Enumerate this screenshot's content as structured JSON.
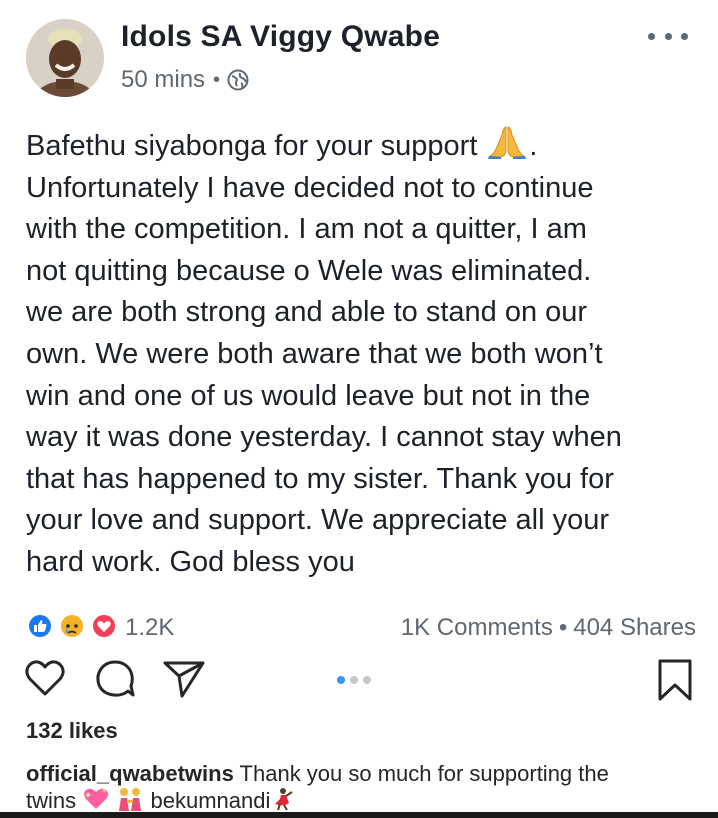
{
  "post": {
    "author": "Idols SA Viggy Qwabe",
    "timestamp": "50 mins",
    "meta_separator": "•",
    "privacy_icon": "globe-icon",
    "more_icon": "more-options-icon",
    "body_lines": [
      "Bafethu siyabonga for your support",
      "Unfortunately I have decided not to continue",
      "with the competition. I am not a quitter, I am",
      "not quitting because o Wele was eliminated.",
      "we are both strong and able to stand on our",
      "own. We were both aware that we both won’t",
      "win and one of us would leave but not in the",
      "way it was done yesterday. I cannot stay when",
      "that has happened to my sister. Thank you for",
      "your love and support. We appreciate all your",
      "hard work. God bless you"
    ],
    "first_line_suffix": ".",
    "reaction_icons": [
      "like-reaction-icon",
      "sad-reaction-icon",
      "love-reaction-icon"
    ],
    "reactions_count": "1.2K",
    "comments": "1K Comments",
    "shares": "404 Shares",
    "engagement_separator": "•"
  },
  "instagram": {
    "action_icons": [
      "heart-icon",
      "comment-icon",
      "share-icon",
      "bookmark-icon"
    ],
    "likes": "132 likes",
    "caption_username": "official_qwabetwins",
    "caption_text_1": " Thank you so much for supporting the",
    "caption_text_2": "twins",
    "caption_text_3": "bekumnandi",
    "caption_emojis": [
      "sparkling-heart-emoji",
      "twins-emoji",
      "dancer-emoji"
    ]
  },
  "colors": {
    "text_primary": "#1d2129",
    "text_secondary": "#606770",
    "like_blue": "#1877f2",
    "love_red": "#f33e58",
    "sad_yellow": "#f7b125",
    "carousel_active": "#3897f0"
  }
}
